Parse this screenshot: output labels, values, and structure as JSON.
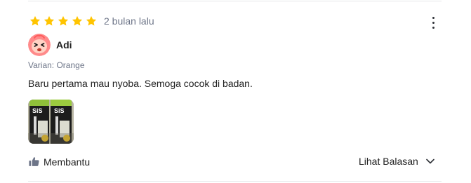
{
  "review": {
    "rating": 5,
    "rating_max": 5,
    "time_ago": "2 bulan lalu",
    "user": {
      "name": "Adi",
      "avatar_icon": "emoji-face-icon"
    },
    "variant": "Varian: Orange",
    "text": "Baru pertama mau nyoba. Semoga cocok di badan.",
    "images": [
      {
        "content": "product-gel-packs-photo"
      }
    ],
    "helpful_label": "Membantu",
    "reply_label": "Lihat Balasan"
  },
  "colors": {
    "star": "#ffc400",
    "muted": "#6d7588",
    "text": "#212121",
    "divider": "#e5e7e9"
  }
}
